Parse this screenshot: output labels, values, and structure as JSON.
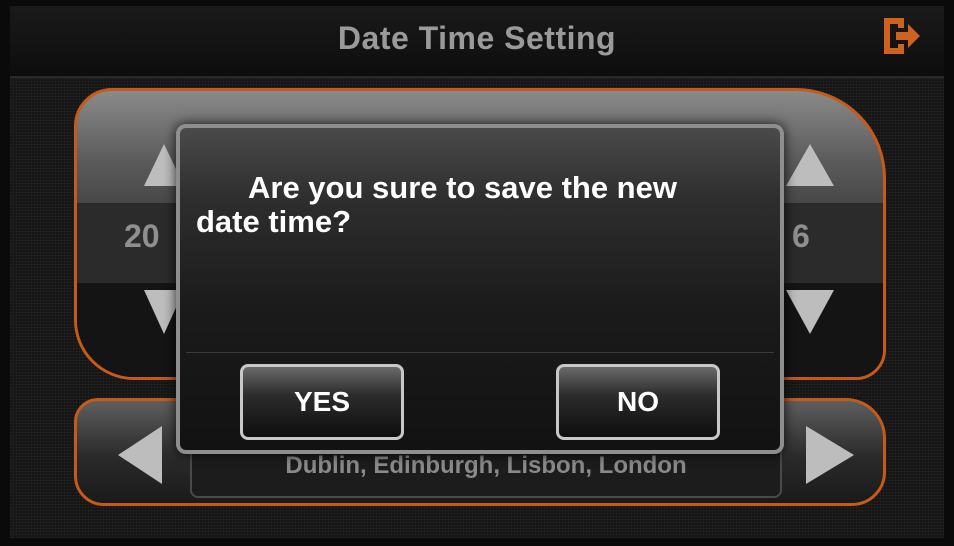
{
  "header": {
    "title": "Date Time Setting",
    "exit_icon": "exit-icon"
  },
  "date_panel": {
    "year_fragment": "20",
    "minute_fragment": "6"
  },
  "timezone": {
    "label": "Dublin, Edinburgh, Lisbon, London"
  },
  "dialog": {
    "message_line1": "Are you sure to save the new",
    "message_line2": "date time?",
    "yes_label": "YES",
    "no_label": "NO"
  },
  "colors": {
    "accent": "#c55a1a",
    "title_text": "#9a9a9a",
    "dialog_text": "#ffffff"
  }
}
